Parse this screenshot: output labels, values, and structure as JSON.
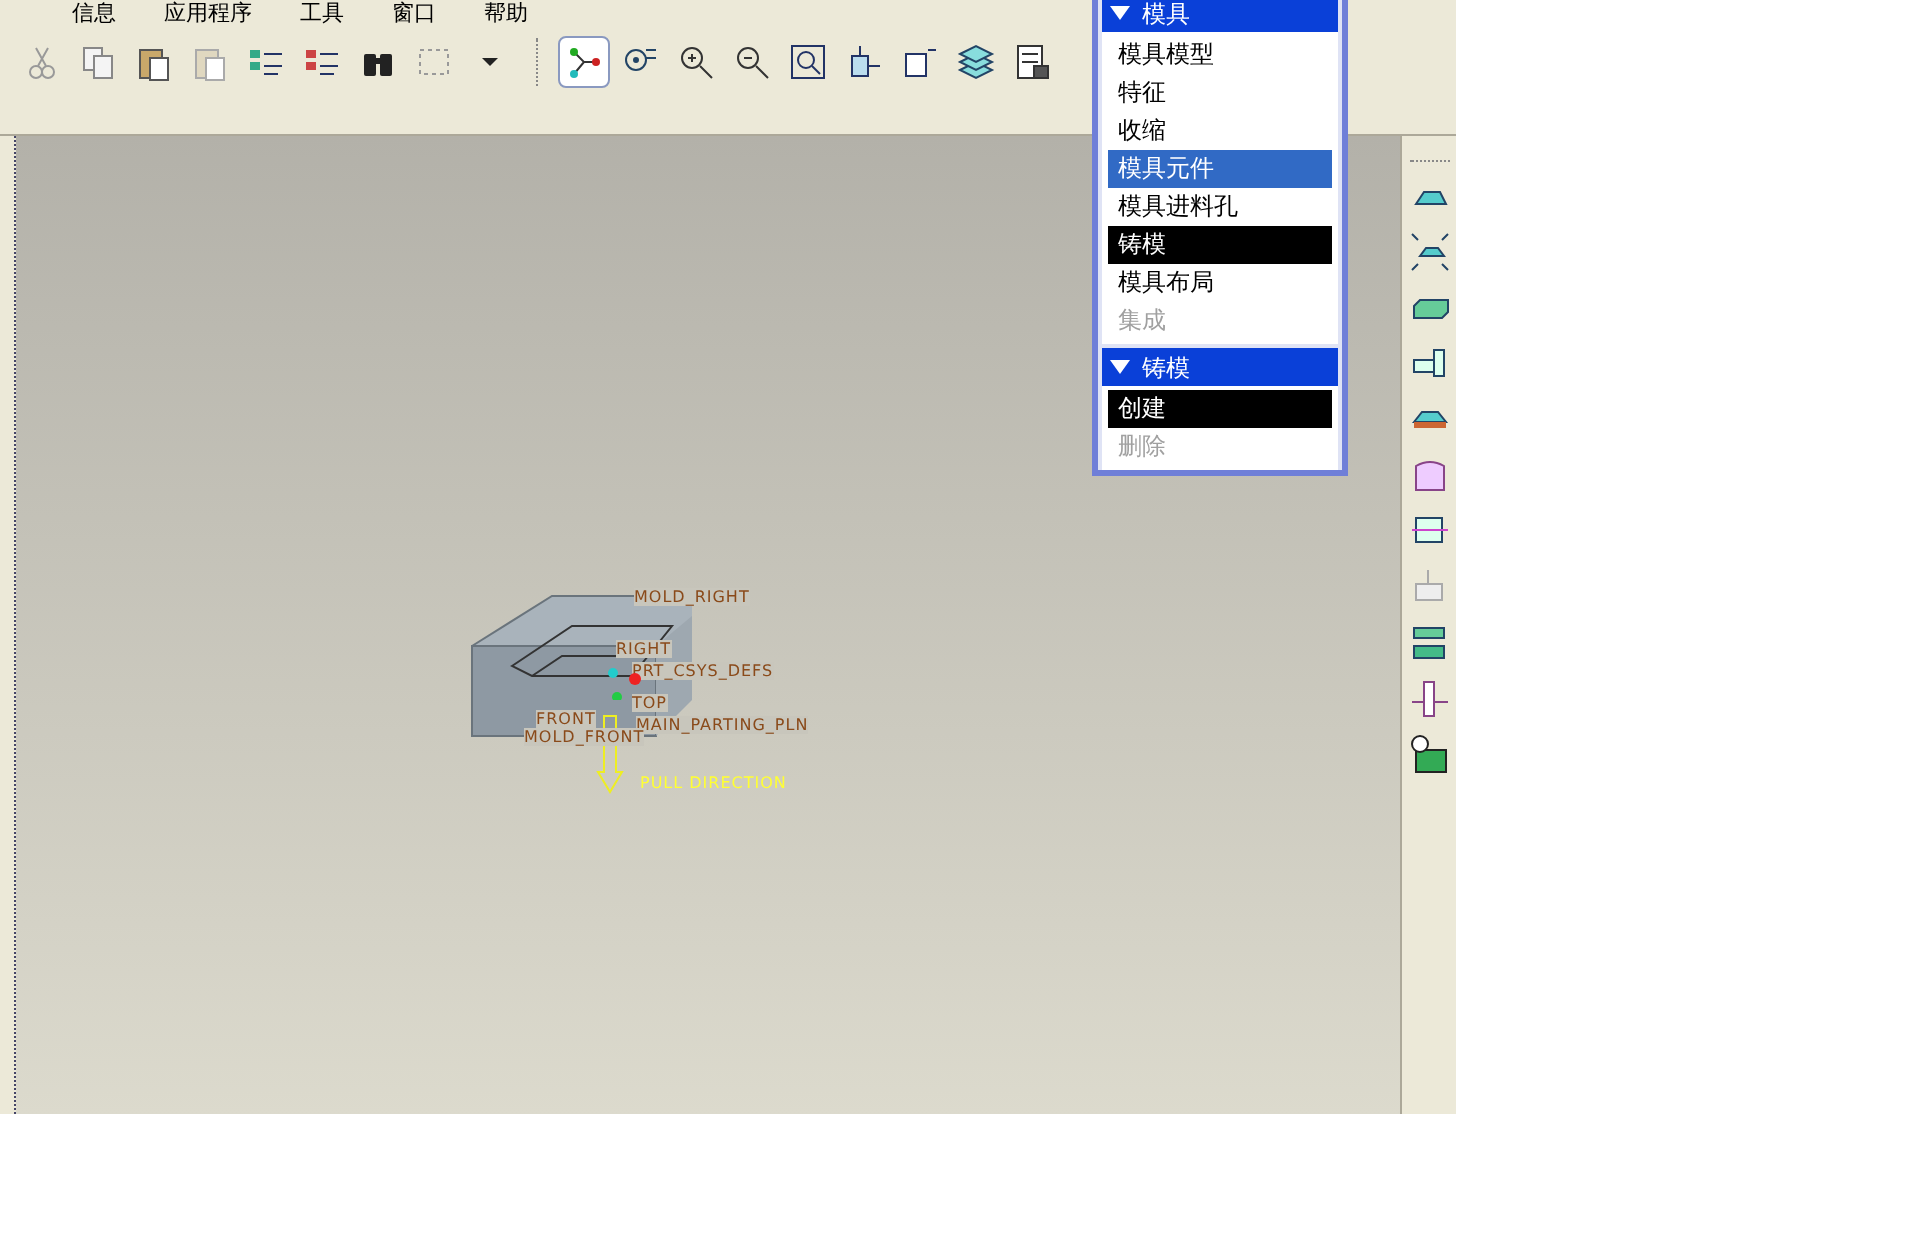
{
  "menu_bar": [
    {
      "label": "信息"
    },
    {
      "label": "应用程序"
    },
    {
      "label": "工具"
    },
    {
      "label": "窗口"
    },
    {
      "label": "帮助"
    }
  ],
  "toolbar": {
    "buttons": [
      {
        "pressed": false
      },
      {
        "pressed": false
      },
      {
        "pressed": false
      },
      {
        "pressed": false
      },
      {
        "pressed": false
      },
      {
        "pressed": false
      },
      {
        "pressed": false
      },
      {
        "pressed": false
      },
      {
        "pressed": false
      },
      {
        "pressed": true
      },
      {
        "pressed": false
      },
      {
        "pressed": false
      },
      {
        "pressed": false
      },
      {
        "pressed": false
      },
      {
        "pressed": false
      },
      {
        "pressed": false
      },
      {
        "pressed": false
      },
      {
        "pressed": false
      }
    ]
  },
  "model_labels": [
    {
      "text": "MOLD_RIGHT",
      "kind": "datum"
    },
    {
      "text": "RIGHT",
      "kind": "datum"
    },
    {
      "text": "PRT_CSYS_DEFS",
      "kind": "datum"
    },
    {
      "text": "FRONT",
      "kind": "datum"
    },
    {
      "text": "TOP",
      "kind": "datum"
    },
    {
      "text": "MAIN_PARTING_PLN",
      "kind": "datum"
    },
    {
      "text": "MOLD_FRONT",
      "kind": "datum"
    },
    {
      "text": "PULL DIRECTION",
      "kind": "direction"
    }
  ],
  "menu_manager": {
    "sections": [
      {
        "title": "模具",
        "items": [
          {
            "label": "模具模型",
            "hovered": false,
            "selected": false,
            "disabled": false
          },
          {
            "label": "特征",
            "hovered": false,
            "selected": false,
            "disabled": false
          },
          {
            "label": "收缩",
            "hovered": false,
            "selected": false,
            "disabled": false
          },
          {
            "label": "模具元件",
            "hovered": true,
            "selected": false,
            "disabled": false
          },
          {
            "label": "模具进料孔",
            "hovered": false,
            "selected": false,
            "disabled": false
          },
          {
            "label": "铸模",
            "hovered": false,
            "selected": true,
            "disabled": false
          },
          {
            "label": "模具布局",
            "hovered": false,
            "selected": false,
            "disabled": false
          },
          {
            "label": "集成",
            "hovered": false,
            "selected": false,
            "disabled": true
          }
        ]
      },
      {
        "title": "铸模",
        "items": [
          {
            "label": "创建",
            "hovered": false,
            "selected": true,
            "disabled": false
          },
          {
            "label": "删除",
            "hovered": false,
            "selected": false,
            "disabled": true
          }
        ]
      }
    ]
  }
}
